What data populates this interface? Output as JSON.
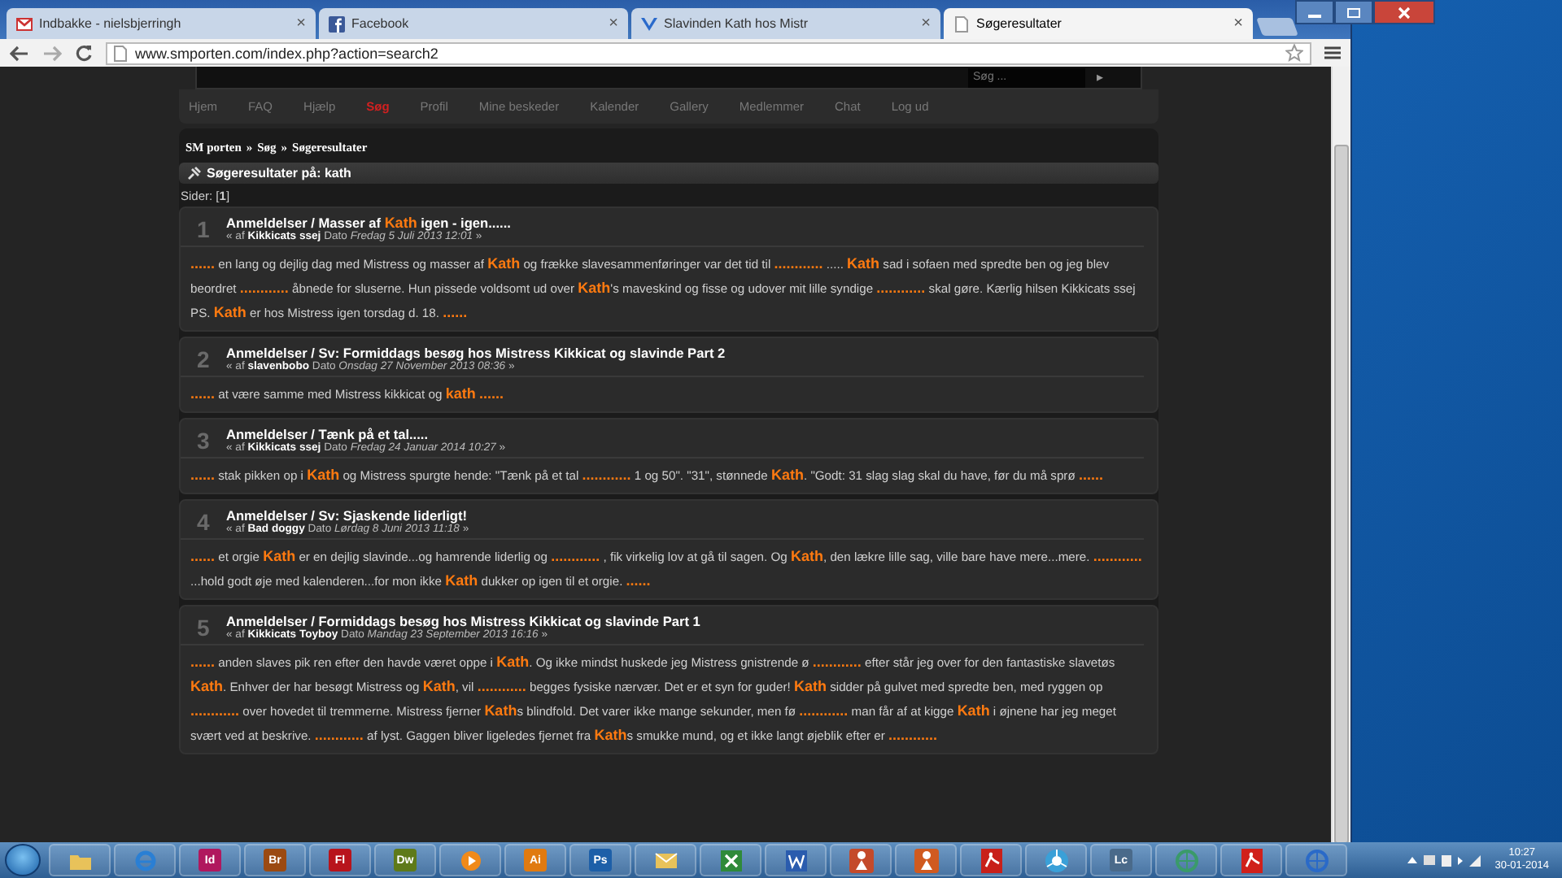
{
  "browser": {
    "tabs": [
      {
        "kind": "mail",
        "title": "Indbakke - nielsbjerringh",
        "close": "×",
        "selected": false
      },
      {
        "kind": "facebook",
        "title": "Facebook",
        "close": "×",
        "selected": false
      },
      {
        "kind": "forum",
        "title": "Slavinden Kath hos Mistr",
        "close": "×",
        "selected": false
      },
      {
        "kind": "page",
        "title": "Søgeresultater",
        "close": "×",
        "selected": true
      }
    ],
    "address": "www.smporten.com/index.php?action=search2"
  },
  "site": {
    "search": {
      "placeholder": "Søg ...",
      "button": "▸"
    },
    "nav": [
      {
        "label": "Hjem",
        "selected": false
      },
      {
        "label": "FAQ",
        "selected": false
      },
      {
        "label": "Hjælp",
        "selected": false
      },
      {
        "label": "Søg",
        "selected": true
      },
      {
        "label": "Profil",
        "selected": false
      },
      {
        "label": "Mine beskeder",
        "selected": false
      },
      {
        "label": "Kalender",
        "selected": false
      },
      {
        "label": "Gallery",
        "selected": false
      },
      {
        "label": "Medlemmer",
        "selected": false
      },
      {
        "label": "Chat",
        "selected": false
      },
      {
        "label": "Log ud",
        "selected": false
      }
    ],
    "breadcrumb": [
      {
        "label": "SM porten"
      },
      {
        "label": "Søg"
      },
      {
        "label": "Søgeresultater"
      }
    ],
    "breadcrumb_separator": "»",
    "heading": "Søgeresultater på: kath",
    "pages": "Sider: [**1**]",
    "results": [
      {
        "number": "1",
        "title": "Anmeldelser / Masser af **Kath** igen - igen......",
        "meta": "« af **Kikkicats ssej** Dato *Fredag 5 Juli 2013 12:01* »",
        "excerpt": "**......**  en lang og dejlig dag med Mistress og masser af **Kath** og frække slavesammenføringer var det tid til  **............** .....  **Kath** sad i sofaen med spredte ben og jeg blev beordret  **............**  åbnede for sluserne. Hun pissede voldsomt ud over **Kath**'s maveskind og fisse og udover mit lille syndige  **............**  skal gøre.   Kærlig hilsen Kikkicats ssej  PS. **Kath** er hos Mistress igen torsdag d. 18.  **......**"
      },
      {
        "number": "2",
        "title": "Anmeldelser / Sv: Formiddags besøg hos Mistress Kikkicat og slavinde Part 2",
        "meta": "« af **slavenbobo** Dato *Onsdag 27 November 2013 08:36* »",
        "excerpt": "**......**  at være samme med Mistress kikkicat og **kath**  **......**"
      },
      {
        "number": "3",
        "title": "Anmeldelser / Tænk på et tal.....",
        "meta": "« af **Kikkicats ssej** Dato *Fredag 24 Januar 2014 10:27* »",
        "excerpt": "**......**  stak pikken op i **Kath** og Mistress spurgte hende:  \"Tænk på et tal  **............**  1 og 50\". \"31\", stønnede **Kath**. \"Godt: 31 slag slag skal du have, før du må sprø **......**"
      },
      {
        "number": "4",
        "title": "Anmeldelser / Sv: Sjaskende liderligt!",
        "meta": "« af **Bad doggy** Dato *Lørdag 8 Juni 2013 11:18* »",
        "excerpt": "**......**  et orgie   **Kath** er en dejlig slavinde...og hamrende liderlig og  **............** , fik virkelig lov at gå til sagen. Og **Kath**, den lækre lille sag, ville bare have mere...mere. **............** ...hold godt øje med kalenderen...for mon ikke **Kath** dukker op igen til et orgie.    **......**"
      },
      {
        "number": "5",
        "title": "Anmeldelser / Formiddags besøg hos Mistress Kikkicat og slavinde Part 1",
        "meta": "« af **Kikkicats Toyboy** Dato *Mandag 23 September 2013 16:16* »",
        "excerpt": "**......**  anden slaves pik ren efter den havde været oppe i **Kath**. Og ikke mindst huskede jeg Mistress gnistrende ø **............**  efter står jeg over for den fantastiske slavetøs **Kath**. Enhver der har besøgt Mistress og **Kath**, vil  **............**  begges fysiske nærvær.  Det er et syn for guder! **Kath** sidder på gulvet med spredte ben, med ryggen op  **............**  over hovedet til tremmerne. Mistress fjerner **Kath**s blindfold. Det varer ikke mange sekunder, men fø **............**  man får af at kigge **Kath** i øjnene har jeg meget svært ved at beskrive.  **............**  af lyst. Gaggen bliver ligeledes fjernet fra **Kath**s smukke mund, og et ikke langt øjeblik efter er  **............**"
      }
    ]
  },
  "taskbar": {
    "items": [
      {
        "kind": "folder",
        "color": "#e8c25a"
      },
      {
        "kind": "ie",
        "color": "#2a7fd4"
      },
      {
        "kind": "app",
        "label": "Id",
        "color": "#b0185e"
      },
      {
        "kind": "app",
        "label": "Br",
        "color": "#9b4a12"
      },
      {
        "kind": "app",
        "label": "Fl",
        "color": "#b8141c"
      },
      {
        "kind": "app",
        "label": "Dw",
        "color": "#5e7a1a"
      },
      {
        "kind": "player",
        "color": "#f08a1a"
      },
      {
        "kind": "app",
        "label": "Ai",
        "color": "#e07a10"
      },
      {
        "kind": "app",
        "label": "Ps",
        "color": "#1d5fa8"
      },
      {
        "kind": "outlook",
        "color": "#e8c25a"
      },
      {
        "kind": "excel",
        "color": "#2f8a3a"
      },
      {
        "kind": "word",
        "color": "#2a5cae"
      },
      {
        "kind": "game",
        "color": "#c44a2a"
      },
      {
        "kind": "game",
        "color": "#d05a20"
      },
      {
        "kind": "pdf",
        "color": "#c8201a"
      },
      {
        "kind": "chrome",
        "color": "#3aa0d8"
      },
      {
        "kind": "app",
        "label": "Lc",
        "color": "#4a6a8a"
      },
      {
        "kind": "globe",
        "color": "#3a9a6a"
      },
      {
        "kind": "pdf",
        "color": "#d0201a"
      },
      {
        "kind": "globe",
        "color": "#2a6ac8"
      }
    ],
    "time": "10:27",
    "date": "30-01-2014"
  }
}
